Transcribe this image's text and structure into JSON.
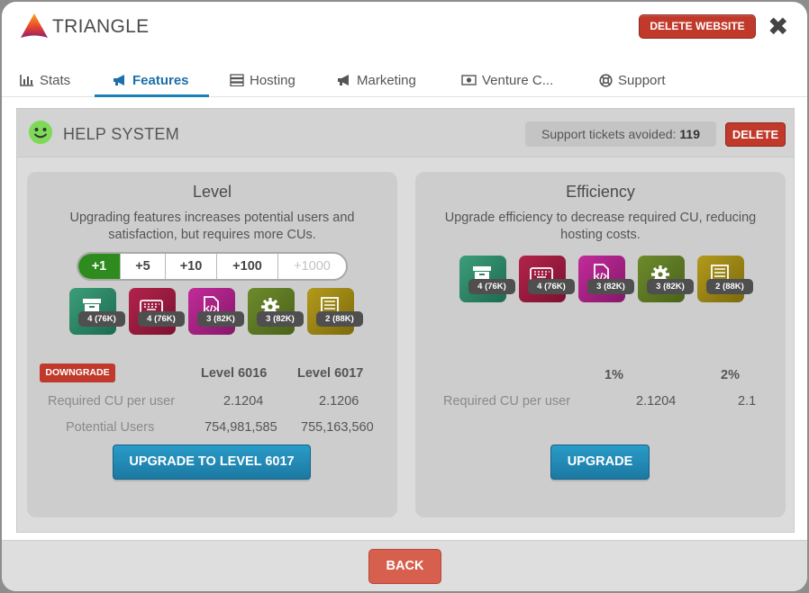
{
  "header": {
    "app_title": "TRIANGLE",
    "delete_website_label": "DELETE WEBSITE",
    "close_icon": "close-icon"
  },
  "tabs": [
    {
      "label": "Stats",
      "icon": "bar-chart-icon",
      "active": false
    },
    {
      "label": "Features",
      "icon": "megaphone-icon",
      "active": true
    },
    {
      "label": "Hosting",
      "icon": "server-icon",
      "active": false
    },
    {
      "label": "Marketing",
      "icon": "megaphone-icon",
      "active": false
    },
    {
      "label": "Venture C...",
      "icon": "money-icon",
      "active": false
    },
    {
      "label": "Support",
      "icon": "lifebuoy-icon",
      "active": false
    }
  ],
  "feature": {
    "title": "HELP SYSTEM",
    "tickets_label": "Support tickets avoided:",
    "tickets_value": "119",
    "delete_label": "DELETE"
  },
  "level": {
    "title": "Level",
    "description": "Upgrading features increases potential users and satisfaction, but requires more CUs.",
    "options": [
      {
        "label": "+1",
        "state": "active"
      },
      {
        "label": "+5",
        "state": "normal"
      },
      {
        "label": "+10",
        "state": "normal"
      },
      {
        "label": "+100",
        "state": "normal"
      },
      {
        "label": "+1000",
        "state": "disabled"
      }
    ],
    "icons": [
      {
        "name": "storage-icon",
        "badge": "4 (76K)",
        "color": "#2e8564"
      },
      {
        "name": "keyboard-icon",
        "badge": "4 (76K)",
        "color": "#9b1c3f"
      },
      {
        "name": "code-file-icon",
        "badge": "3 (82K)",
        "color": "#a8217f"
      },
      {
        "name": "gear-icon",
        "badge": "3 (82K)",
        "color": "#5f7a24"
      },
      {
        "name": "server-rack-icon",
        "badge": "2 (88K)",
        "color": "#a08812"
      }
    ],
    "downgrade_label": "DOWNGRADE",
    "col_current": "Level 6016",
    "col_next": "Level 6017",
    "rows": [
      {
        "label": "Required CU per user",
        "current": "2.1204",
        "next": "2.1206"
      },
      {
        "label": "Potential Users",
        "current": "754,981,585",
        "next": "755,163,560"
      }
    ],
    "upgrade_label": "UPGRADE TO LEVEL 6017"
  },
  "efficiency": {
    "title": "Efficiency",
    "description": "Upgrade efficiency to decrease required CU, reducing hosting costs.",
    "icons": [
      {
        "name": "storage-icon",
        "badge": "4 (76K)",
        "color": "#2e8564"
      },
      {
        "name": "keyboard-icon",
        "badge": "4 (76K)",
        "color": "#9b1c3f"
      },
      {
        "name": "code-file-icon",
        "badge": "3 (82K)",
        "color": "#a8217f"
      },
      {
        "name": "gear-icon",
        "badge": "3 (82K)",
        "color": "#5f7a24"
      },
      {
        "name": "server-rack-icon",
        "badge": "2 (88K)",
        "color": "#a08812"
      }
    ],
    "col_current": "1%",
    "col_next": "2%",
    "rows": [
      {
        "label": "Required CU per user",
        "current": "2.1204",
        "next": "2.1"
      }
    ],
    "upgrade_label": "UPGRADE"
  },
  "footer": {
    "back_label": "BACK"
  },
  "colors": {
    "accent_blue": "#1c6fa8",
    "danger_red": "#c0392b",
    "active_green": "#2e8b1e",
    "back_button": "#d75f4d"
  }
}
